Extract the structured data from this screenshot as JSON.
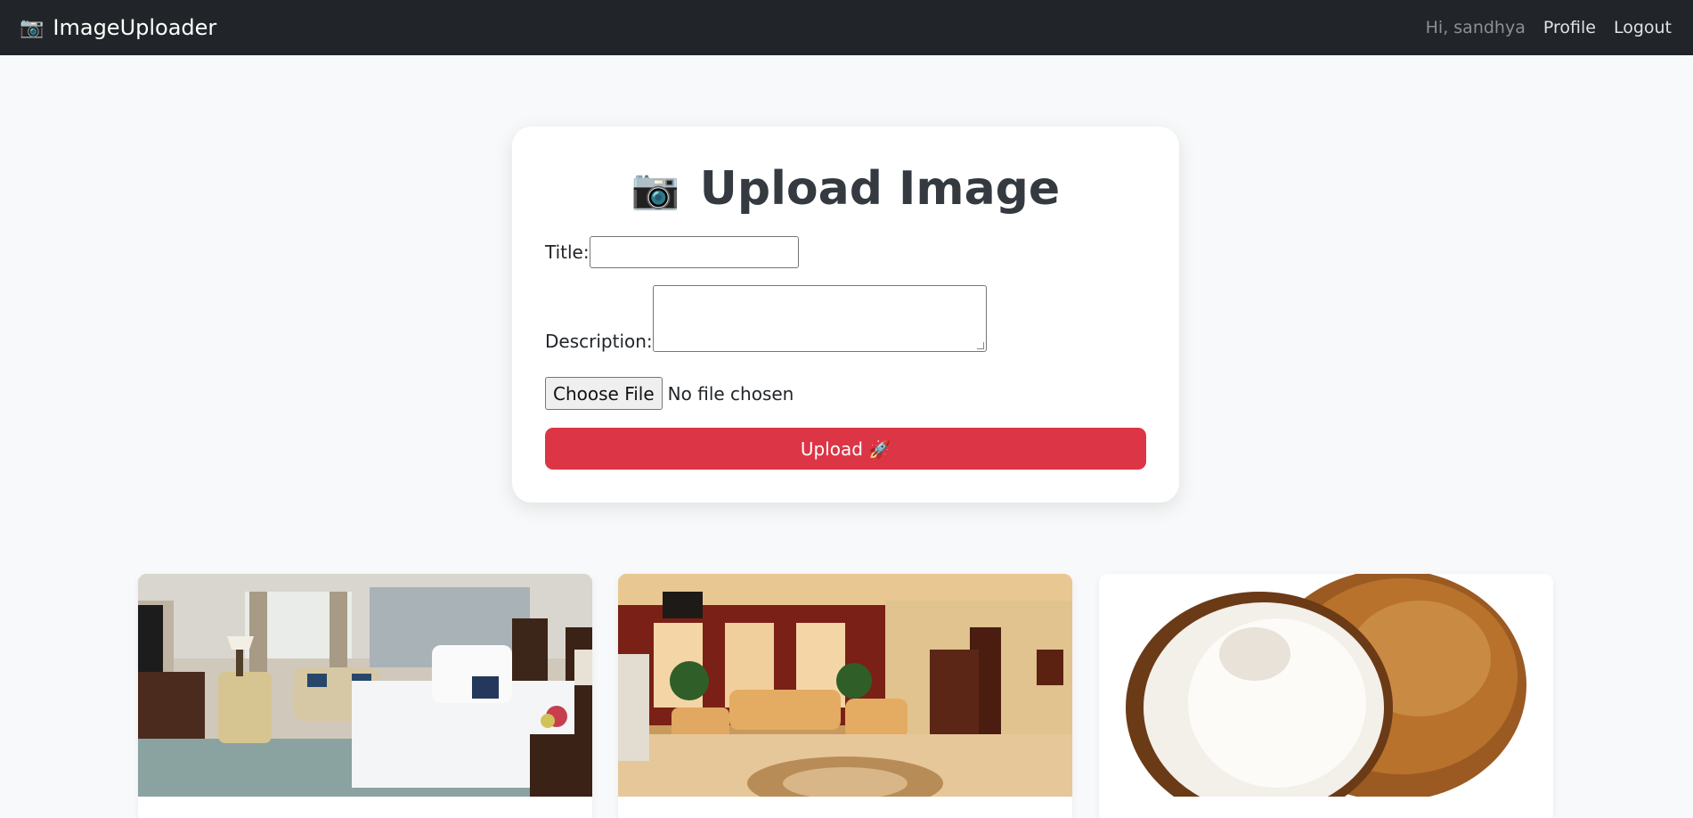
{
  "navbar": {
    "brand_icon": "camera-icon",
    "brand_glyph": "📷",
    "brand": "ImageUploader",
    "greeting": "Hi, sandhya",
    "profile": "Profile",
    "logout": "Logout"
  },
  "upload_card": {
    "title_glyph": "📷",
    "title": "Upload Image",
    "title_label": "Title:",
    "title_value": "",
    "description_label": "Description:",
    "description_value": "",
    "choose_file": "Choose File",
    "file_status": "No file chosen",
    "upload_label": "Upload 🚀"
  },
  "gallery": [
    {
      "alt": "hotel bedroom"
    },
    {
      "alt": "hotel lobby"
    },
    {
      "alt": "coconut"
    }
  ],
  "colors": {
    "navbar_bg": "#212529",
    "page_bg": "#f8f9fa",
    "upload_button": "#dc3545"
  }
}
